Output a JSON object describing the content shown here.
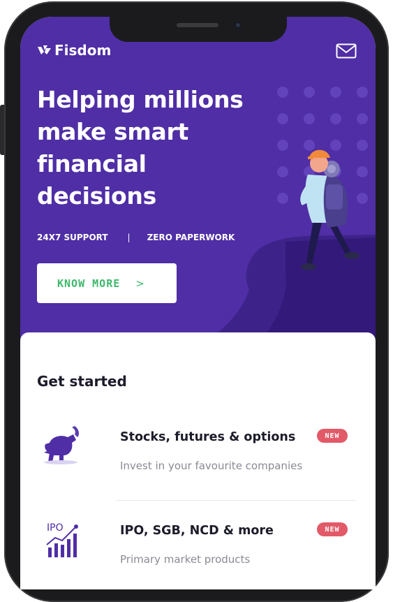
{
  "brand": {
    "name": "Fisdom",
    "primary_color": "#4f2ea6",
    "accent_green": "#3fb86b",
    "badge_color": "#e25a68"
  },
  "header": {
    "logo_icon": "fisdom-logo-icon",
    "mail_icon": "mail-icon"
  },
  "hero": {
    "headline_lines": [
      "Helping millions",
      "make smart",
      "financial",
      "decisions"
    ],
    "features": [
      "24X7 SUPPORT",
      "|",
      "ZERO PAPERWORK"
    ],
    "cta_label": "KNOW MORE",
    "cta_chevron": ">",
    "illustration": "hiker-on-cliff-illustration"
  },
  "get_started": {
    "title": "Get started",
    "items": [
      {
        "icon": "bull-icon",
        "title": "Stocks, futures & options",
        "subtitle": "Invest in your favourite companies",
        "badge": "NEW"
      },
      {
        "icon": "ipo-chart-icon",
        "icon_text": "IPO",
        "title": "IPO, SGB, NCD & more",
        "subtitle": "Primary market products",
        "badge": "NEW"
      }
    ]
  }
}
